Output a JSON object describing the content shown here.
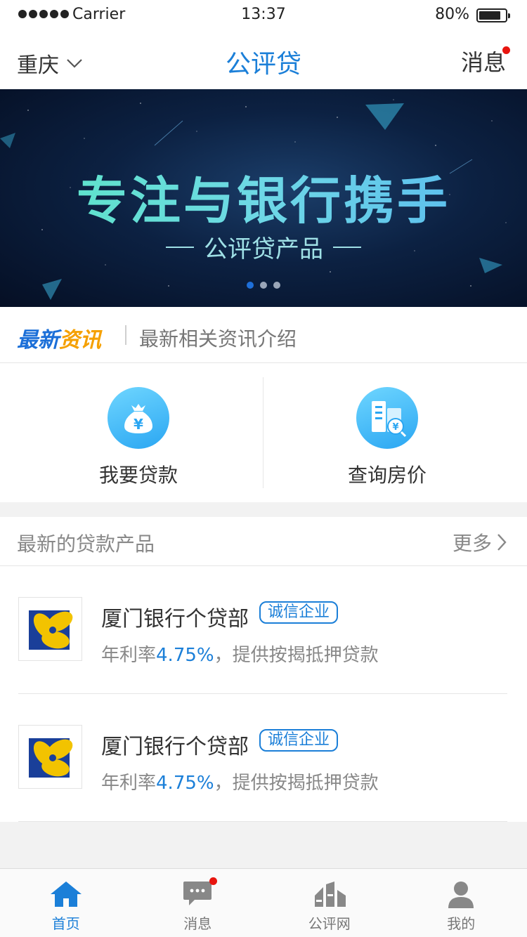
{
  "status_bar": {
    "carrier": "Carrier",
    "time": "13:37",
    "battery_percent": "80%",
    "battery_level": 0.8,
    "signal_dots": 5
  },
  "nav": {
    "city": "重庆",
    "title": "公评贷",
    "messages": "消息",
    "has_unread": true
  },
  "banner": {
    "headline": "专注与银行携手",
    "subtitle": "公评贷产品",
    "slide_count": 3,
    "active_slide": 0
  },
  "news": {
    "logo_part1": "最新",
    "logo_part2": "资讯",
    "text": "最新相关资讯介绍"
  },
  "actions": [
    {
      "label": "我要贷款",
      "icon": "money-bag-icon"
    },
    {
      "label": "查询房价",
      "icon": "house-price-search-icon"
    }
  ],
  "products": {
    "title": "最新的贷款产品",
    "more": "更多",
    "items": [
      {
        "name": "厦门银行个贷部",
        "badge": "诚信企业",
        "desc_prefix": "年利率",
        "rate": "4.75%",
        "desc_suffix": "，提供按揭抵押贷款"
      },
      {
        "name": "厦门银行个贷部",
        "badge": "诚信企业",
        "desc_prefix": "年利率",
        "rate": "4.75%",
        "desc_suffix": "，提供按揭抵押贷款"
      }
    ]
  },
  "tabs": [
    {
      "label": "首页",
      "icon": "home-icon",
      "active": true
    },
    {
      "label": "消息",
      "icon": "chat-bubble-icon",
      "has_dot": true
    },
    {
      "label": "公评网",
      "icon": "gongping-logo-icon"
    },
    {
      "label": "我的",
      "icon": "user-icon"
    }
  ],
  "colors": {
    "brand_blue": "#1b7fd8",
    "accent_orange": "#f5a000",
    "alert_red": "#e8150f",
    "background": "#f2f2f2"
  }
}
